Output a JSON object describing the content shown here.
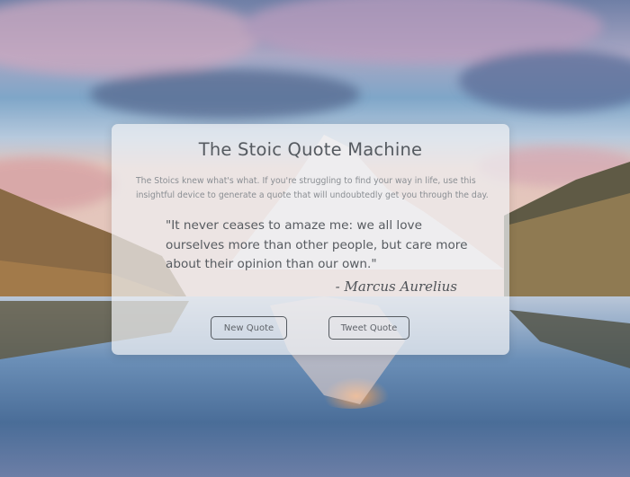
{
  "background": {
    "description_icon": "mountain-lake-reflection-icon"
  },
  "card": {
    "title": "The Stoic Quote Machine",
    "intro": "The Stoics knew what's what. If you're struggling to find your way in life, use this insightful device to generate a quote that will undoubtedly get you through the day.",
    "quote": "\"It never ceases to amaze me: we all love ourselves more than other people, but care more about their opinion than our own.\"",
    "author": "- Marcus Aurelius",
    "buttons": {
      "new_quote": "New Quote",
      "tweet_quote": "Tweet Quote"
    }
  }
}
